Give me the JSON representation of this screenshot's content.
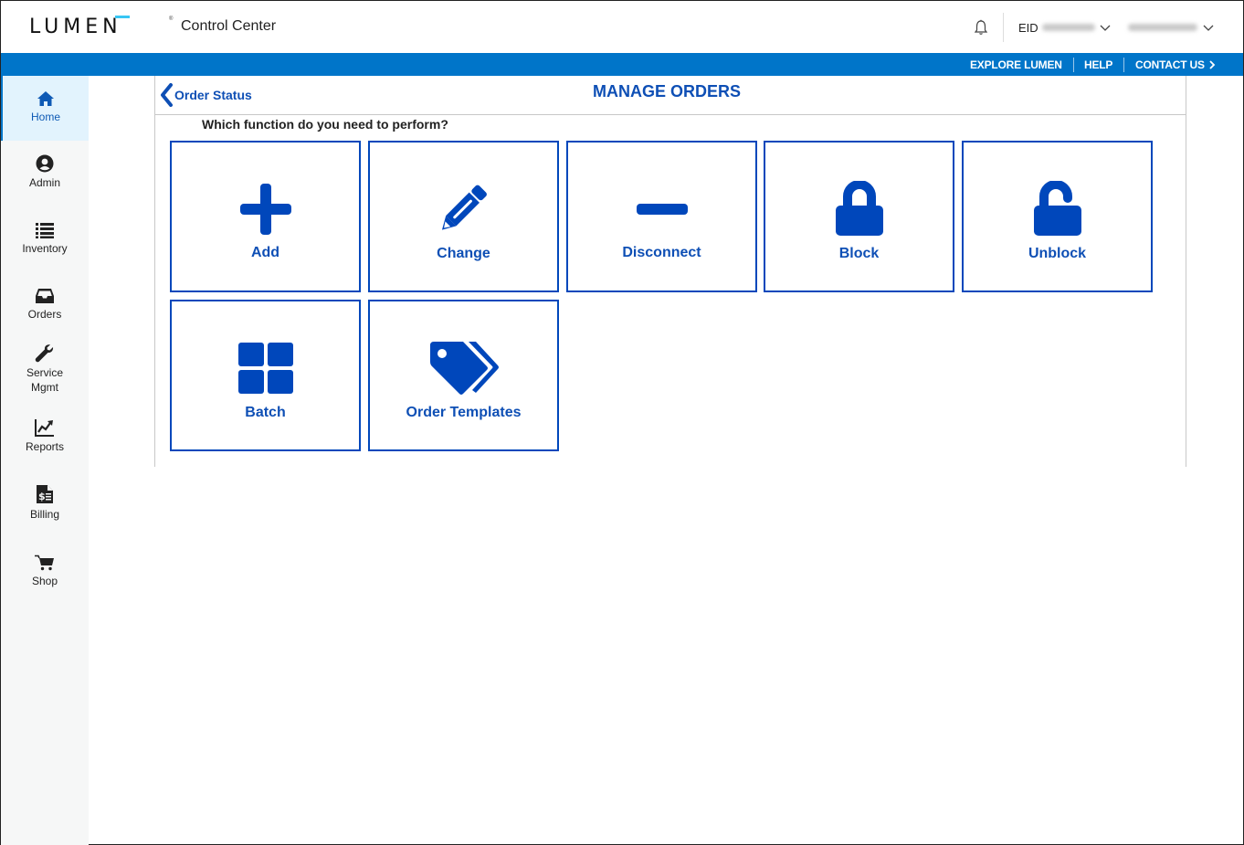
{
  "header": {
    "brand": "LUMEN",
    "app_title": "Control Center",
    "eid_label": "EID",
    "eid_value": "[redacted]",
    "username": "[redacted]",
    "icons": [
      "bell-icon",
      "chevron-down-icon"
    ]
  },
  "utility_bar": {
    "links": [
      "EXPLORE LUMEN",
      "HELP",
      "CONTACT US"
    ],
    "colors": {
      "background": "#0075c9",
      "text": "#ffffff"
    }
  },
  "sidebar": {
    "items": [
      {
        "label": "Home",
        "icon": "home-icon",
        "active": true
      },
      {
        "label": "Admin",
        "icon": "user-circle-icon",
        "active": false
      },
      {
        "label": "Inventory",
        "icon": "list-icon",
        "active": false
      },
      {
        "label": "Orders",
        "icon": "inbox-icon",
        "active": false
      },
      {
        "label": "Service Mgmt",
        "label_line1": "Service",
        "label_line2": "Mgmt",
        "icon": "wrench-icon",
        "active": false
      },
      {
        "label": "Reports",
        "icon": "chart-line-icon",
        "active": false
      },
      {
        "label": "Billing",
        "icon": "invoice-icon",
        "active": false
      },
      {
        "label": "Shop",
        "icon": "cart-icon",
        "active": false
      }
    ]
  },
  "main": {
    "back_link": "Order Status",
    "title": "MANAGE ORDERS",
    "question": "Which function do you need to perform?",
    "tiles": [
      {
        "label": "Add",
        "icon": "plus-icon"
      },
      {
        "label": "Change",
        "icon": "pencil-icon"
      },
      {
        "label": "Disconnect",
        "icon": "minus-icon"
      },
      {
        "label": "Block",
        "icon": "lock-icon"
      },
      {
        "label": "Unblock",
        "icon": "unlock-icon"
      },
      {
        "label": "Batch",
        "icon": "grid-icon"
      },
      {
        "label": "Order Templates",
        "icon": "tags-icon"
      }
    ],
    "colors": {
      "accent": "#0047bb",
      "title": "#0e4fb5"
    }
  }
}
